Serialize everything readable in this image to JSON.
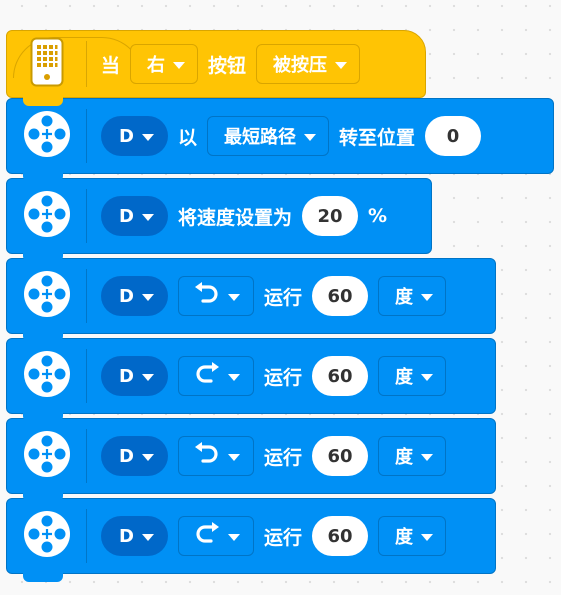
{
  "hat": {
    "when_label": "当",
    "button_side": "右",
    "button_label": "按钮",
    "button_state": "被按压",
    "icon": "hub-icon"
  },
  "blocks": [
    {
      "port": "D",
      "label_before": "以",
      "mode": "最短路径",
      "label_after": "转至位置",
      "value": "0"
    },
    {
      "port": "D",
      "label": "将速度设置为",
      "value": "20",
      "unit": "%"
    },
    {
      "port": "D",
      "direction": "counterclockwise",
      "label": "运行",
      "value": "60",
      "unit": "度"
    },
    {
      "port": "D",
      "direction": "clockwise",
      "label": "运行",
      "value": "60",
      "unit": "度"
    },
    {
      "port": "D",
      "direction": "counterclockwise",
      "label": "运行",
      "value": "60",
      "unit": "度"
    },
    {
      "port": "D",
      "direction": "clockwise",
      "label": "运行",
      "value": "60",
      "unit": "度"
    }
  ],
  "colors": {
    "events": "#ffc404",
    "motors": "#0090f5",
    "port_pill": "#0068c9",
    "background": "#f9f9f9"
  }
}
